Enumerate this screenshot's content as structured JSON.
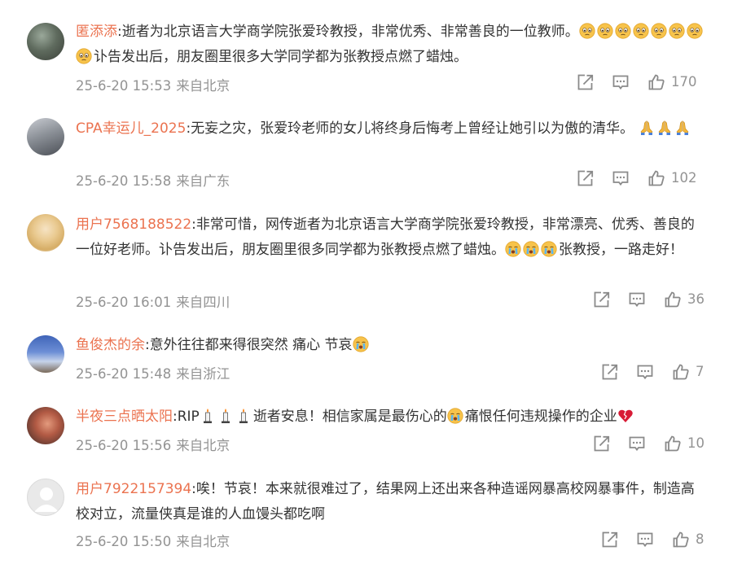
{
  "comments": [
    {
      "user": "匿添添",
      "text_parts": [
        ":逝者为北京语言大学商学院张爱玲教授，非常优秀、非常善良的一位教师。",
        "",
        "讣告发出后，朋友圈里很多大学同学都为张教授点燃了蜡烛。"
      ],
      "emojis": [
        "sad-face-emoji",
        "sad-face-emoji",
        "sad-face-emoji",
        "sad-face-emoji",
        "sad-face-emoji",
        "sad-face-emoji",
        "sad-face-emoji",
        "sad-face-emoji"
      ],
      "time": "25-6-20 15:53",
      "location": "来自北京",
      "likes": "170"
    },
    {
      "user": "CPA幸运儿_2025",
      "text_parts": [
        ":无妄之灾，张爱玲老师的女儿将终身后悔考上曾经让她引以为傲的清华。"
      ],
      "emojis": [
        "pray-hands-emoji",
        "pray-hands-emoji",
        "pray-hands-emoji"
      ],
      "time": "25-6-20 15:58",
      "location": "来自广东",
      "likes": "102"
    },
    {
      "user": "用户7568188522",
      "text_parts": [
        ":非常可惜，网传逝者为北京语言大学商学院张爱玲教授，非常漂亮、优秀、善良的一位好老师。讣告发出后，朋友圈里很多同学都为张教授点燃了蜡烛。",
        "张教授，一路走好！"
      ],
      "emojis": [
        "crying-face-emoji",
        "crying-face-emoji",
        "crying-face-emoji"
      ],
      "time": "25-6-20 16:01",
      "location": "来自四川",
      "likes": "36"
    },
    {
      "user": "鱼俊杰的余",
      "text_parts": [
        ":意外往往都来得很突然 痛心 节哀"
      ],
      "emojis": [
        "crying-face-emoji"
      ],
      "time": "25-6-20 15:48",
      "location": "来自浙江",
      "likes": "7"
    },
    {
      "user": "半夜三点晒太阳",
      "text_parts": [
        ":RIP",
        "逝者安息！相信家属是最伤心的",
        "痛恨任何违规操作的企业"
      ],
      "emojis": [
        "candle-emoji",
        "candle-emoji",
        "candle-emoji",
        "crying-face-emoji",
        "broken-heart-emoji"
      ],
      "time": "25-6-20 15:56",
      "location": "来自北京",
      "likes": "10"
    },
    {
      "user": "用户7922157394",
      "text_parts": [
        ":唉！节哀！本来就很难过了，结果网上还出来各种造谣网暴高校网暴事件，制造高校对立，流量侠真是谁的人血馒头都吃啊"
      ],
      "emojis": [],
      "time": "25-6-20 15:50",
      "location": "来自北京",
      "likes": "8"
    }
  ],
  "icons": {
    "share": "share-icon",
    "comment": "comment-icon",
    "like": "like-icon"
  },
  "colors": {
    "username": "#eb7350",
    "meta": "#939393",
    "text": "#333333"
  }
}
